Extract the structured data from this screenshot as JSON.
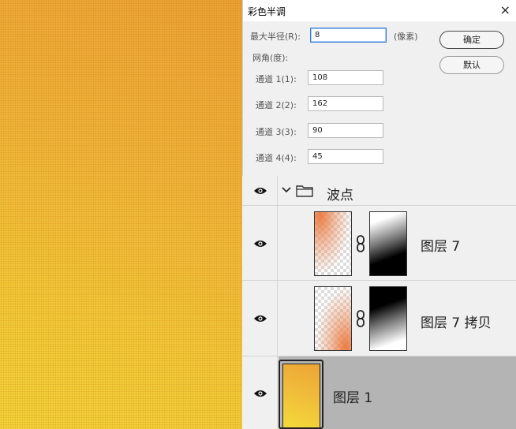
{
  "dialog": {
    "title": "彩色半调",
    "close_glyph": "×",
    "max_radius_label": "最大半径(R):",
    "max_radius_value": "8",
    "unit_label": "(像素)",
    "screen_angles_label": "网角(度):",
    "channels": [
      {
        "label": "通道 1(1):",
        "value": "108"
      },
      {
        "label": "通道 2(2):",
        "value": "162"
      },
      {
        "label": "通道 3(3):",
        "value": "90"
      },
      {
        "label": "通道 4(4):",
        "value": "45"
      }
    ],
    "ok_label": "确定",
    "default_label": "默认"
  },
  "layers": {
    "group": {
      "name": "波点",
      "icons": [
        "eye-icon",
        "chevron-down-icon",
        "folder-icon"
      ]
    },
    "items": [
      {
        "name": "图层 7",
        "icons": [
          "eye-icon",
          "chain-link-icon"
        ]
      },
      {
        "name": "图层 7 拷贝",
        "icons": [
          "eye-icon",
          "chain-link-icon"
        ]
      },
      {
        "name": "图层 1",
        "icons": [
          "eye-icon"
        ],
        "selected": true
      }
    ]
  },
  "colors": {
    "selected_row": "#b4b4b4",
    "focus_border": "#2f7ad6",
    "canvas_yellow": "#f3cc39",
    "canvas_orange": "#eca535"
  }
}
